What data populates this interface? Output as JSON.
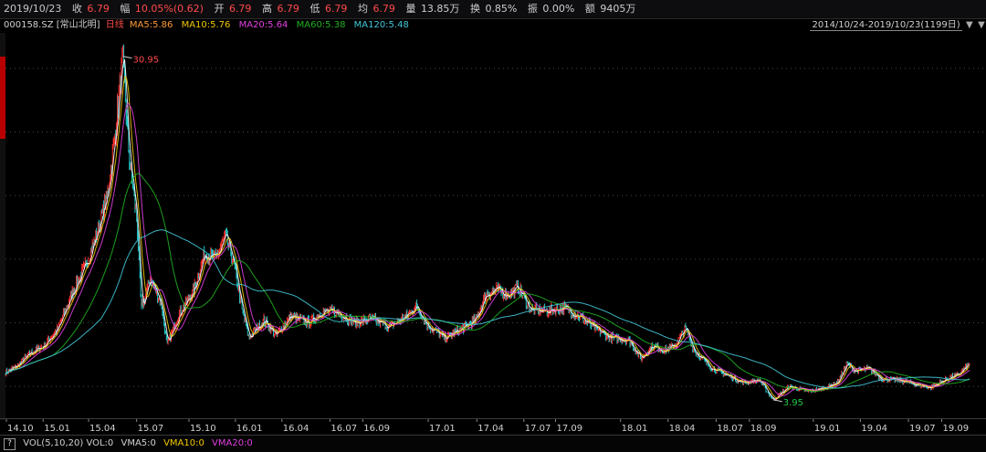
{
  "header": {
    "date": "2019/10/23",
    "close_label": "收",
    "close": "6.79",
    "change_label": "幅",
    "change": "10.05%(0.62)",
    "open_label": "开",
    "open": "6.79",
    "high_label": "高",
    "high": "6.79",
    "low_label": "低",
    "low": "6.79",
    "avg_label": "均",
    "avg": "6.79",
    "volume_label": "量",
    "volume": "13.85万",
    "turnover_label": "换",
    "turnover": "0.85%",
    "amplitude_label": "振",
    "amplitude": "0.00%",
    "amount_label": "额",
    "amount": "9405万"
  },
  "ma_legend": {
    "stock": "000158.SZ [常山北明]",
    "period": "日线",
    "ma5": "MA5:5.86",
    "ma10": "MA10:5.76",
    "ma20": "MA20:5.64",
    "ma60": "MA60:5.38",
    "ma120": "MA120:5.48"
  },
  "range": {
    "text": "2014/10/24-2019/10/23(1199日)",
    "prev_icon": "▼",
    "next_icon": "▼"
  },
  "volume_legend": {
    "help": "?",
    "vol": "VOL(5,10,20) VOL:0",
    "vma5": "VMA5:0",
    "vma10": "VMA10:0",
    "vma20": "VMA20:0"
  },
  "colors": {
    "background": "#000000",
    "ma5": "#ffffff",
    "ma10": "#f0c800",
    "ma20": "#e040e0",
    "ma60": "#20b020",
    "ma120": "#40c8d8",
    "up": "#ff3030",
    "down": "#20c8c8",
    "grid": "#4a4a4a"
  },
  "chart_data": {
    "type": "line",
    "title": "000158.SZ [常山北明] 日线",
    "x_tick_labels": [
      "14.10",
      "15.01",
      "15.04",
      "15.07",
      "15.10",
      "16.01",
      "16.04",
      "16.07",
      "16.09",
      "17.01",
      "17.04",
      "17.07",
      "17.09",
      "18.01",
      "18.04",
      "18.07",
      "18.09",
      "19.01",
      "19.04",
      "19.07",
      "19.09"
    ],
    "x_range": [
      "2014/10/24",
      "2019/10/23"
    ],
    "trading_days": 1199,
    "y_range": [
      2.5,
      32.5
    ],
    "annotations": [
      {
        "label": "30.95",
        "date": "2015-06-03",
        "value": 30.95,
        "kind": "max"
      },
      {
        "label": "3.95",
        "date": "2018-10-16",
        "value": 3.95,
        "kind": "min"
      }
    ],
    "price_path": [
      [
        "2014-10-24",
        6.1
      ],
      [
        "2014-11-15",
        6.6
      ],
      [
        "2014-12-10",
        7.6
      ],
      [
        "2015-01-05",
        8.2
      ],
      [
        "2015-02-01",
        9.6
      ],
      [
        "2015-03-01",
        12.5
      ],
      [
        "2015-03-25",
        14.5
      ],
      [
        "2015-04-15",
        17.0
      ],
      [
        "2015-05-05",
        20.0
      ],
      [
        "2015-05-20",
        25.0
      ],
      [
        "2015-06-03",
        30.95
      ],
      [
        "2015-06-15",
        23.0
      ],
      [
        "2015-06-30",
        18.0
      ],
      [
        "2015-07-08",
        11.0
      ],
      [
        "2015-07-25",
        13.5
      ],
      [
        "2015-08-15",
        11.5
      ],
      [
        "2015-08-26",
        8.2
      ],
      [
        "2015-09-15",
        10.5
      ],
      [
        "2015-10-15",
        12.5
      ],
      [
        "2015-11-05",
        15.5
      ],
      [
        "2015-11-25",
        15.0
      ],
      [
        "2015-12-15",
        16.8
      ],
      [
        "2015-12-31",
        14.5
      ],
      [
        "2016-01-15",
        11.0
      ],
      [
        "2016-01-28",
        8.8
      ],
      [
        "2016-02-25",
        10.2
      ],
      [
        "2016-03-20",
        9.0
      ],
      [
        "2016-04-15",
        10.5
      ],
      [
        "2016-05-20",
        10.0
      ],
      [
        "2016-06-15",
        10.9
      ],
      [
        "2016-07-15",
        10.8
      ],
      [
        "2016-08-15",
        10.0
      ],
      [
        "2016-09-15",
        10.3
      ],
      [
        "2016-10-20",
        9.7
      ],
      [
        "2016-11-20",
        10.5
      ],
      [
        "2016-12-10",
        11.3
      ],
      [
        "2016-12-31",
        9.8
      ],
      [
        "2017-02-01",
        8.8
      ],
      [
        "2017-03-01",
        9.4
      ],
      [
        "2017-04-01",
        10.2
      ],
      [
        "2017-04-20",
        12.2
      ],
      [
        "2017-05-10",
        12.6
      ],
      [
        "2017-06-01",
        12.2
      ],
      [
        "2017-06-20",
        12.8
      ],
      [
        "2017-07-15",
        11.0
      ],
      [
        "2017-08-15",
        10.9
      ],
      [
        "2017-09-15",
        11.2
      ],
      [
        "2017-10-15",
        10.5
      ],
      [
        "2017-11-15",
        9.5
      ],
      [
        "2017-12-15",
        8.8
      ],
      [
        "2018-01-15",
        8.7
      ],
      [
        "2018-02-08",
        7.2
      ],
      [
        "2018-03-01",
        8.2
      ],
      [
        "2018-03-25",
        7.8
      ],
      [
        "2018-04-15",
        8.3
      ],
      [
        "2018-05-03",
        9.6
      ],
      [
        "2018-05-20",
        7.8
      ],
      [
        "2018-06-20",
        6.5
      ],
      [
        "2018-07-20",
        5.9
      ],
      [
        "2018-08-20",
        5.3
      ],
      [
        "2018-09-20",
        5.5
      ],
      [
        "2018-10-16",
        3.95
      ],
      [
        "2018-11-15",
        5.0
      ],
      [
        "2018-12-20",
        4.6
      ],
      [
        "2019-01-15",
        4.8
      ],
      [
        "2019-02-15",
        5.3
      ],
      [
        "2019-03-05",
        6.8
      ],
      [
        "2019-03-20",
        6.2
      ],
      [
        "2019-04-15",
        6.4
      ],
      [
        "2019-05-10",
        5.6
      ],
      [
        "2019-06-10",
        5.5
      ],
      [
        "2019-07-10",
        5.2
      ],
      [
        "2019-08-10",
        4.9
      ],
      [
        "2019-09-10",
        5.6
      ],
      [
        "2019-10-01",
        5.9
      ],
      [
        "2019-10-23",
        6.79
      ]
    ],
    "series": [
      {
        "name": "MA5",
        "latest": 5.86
      },
      {
        "name": "MA10",
        "latest": 5.76
      },
      {
        "name": "MA20",
        "latest": 5.64
      },
      {
        "name": "MA60",
        "latest": 5.38
      },
      {
        "name": "MA120",
        "latest": 5.48
      }
    ],
    "legend_position": "top-left",
    "grid": true
  }
}
